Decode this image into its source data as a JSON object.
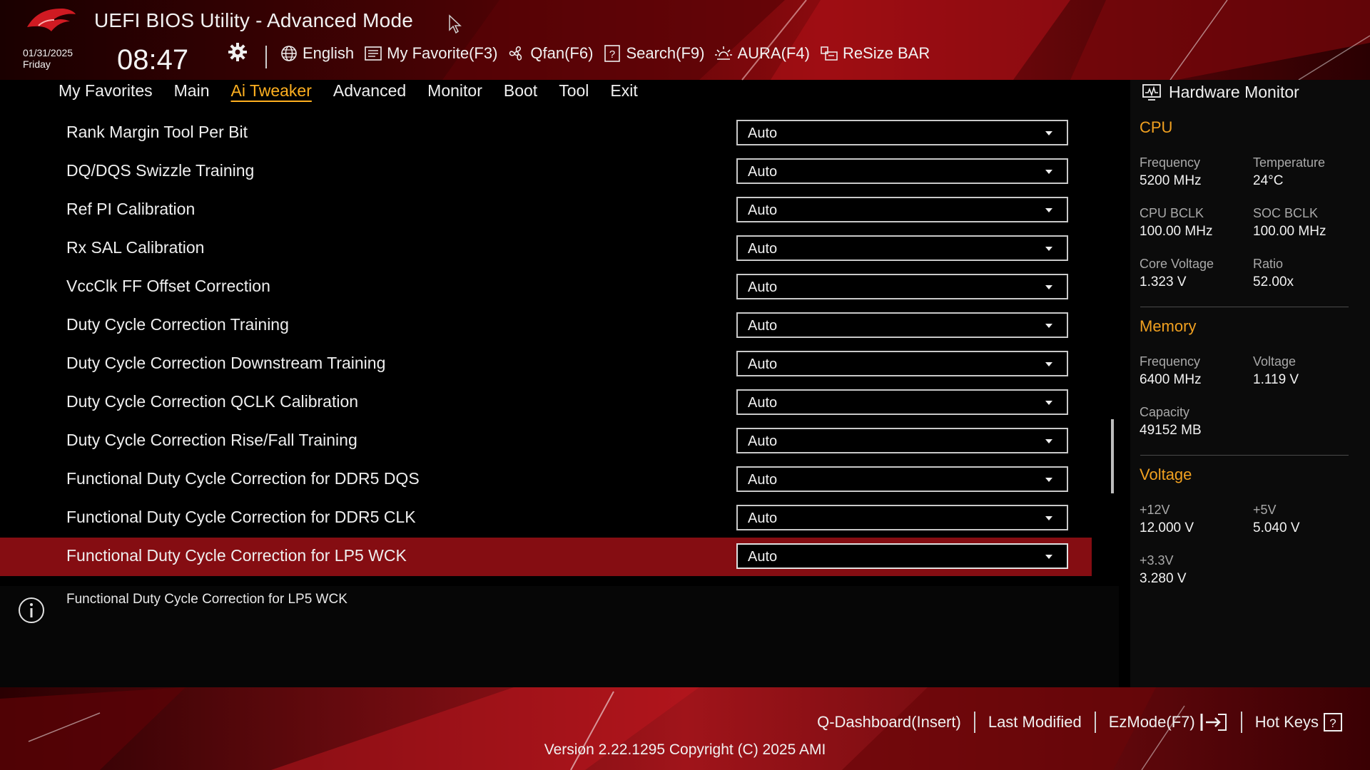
{
  "app": {
    "title": "UEFI BIOS Utility - Advanced Mode",
    "date": "01/31/2025",
    "weekday": "Friday",
    "time": "08:47"
  },
  "toolbar": {
    "items": [
      {
        "label": "English",
        "icon": "globe-icon"
      },
      {
        "label": "My Favorite(F3)",
        "icon": "favorite-icon"
      },
      {
        "label": "Qfan(F6)",
        "icon": "fan-icon"
      },
      {
        "label": "Search(F9)",
        "icon": "search-icon"
      },
      {
        "label": "AURA(F4)",
        "icon": "aura-icon"
      },
      {
        "label": "ReSize BAR",
        "icon": "resize-bar-icon"
      }
    ]
  },
  "menu": {
    "items": [
      "My Favorites",
      "Main",
      "Ai Tweaker",
      "Advanced",
      "Monitor",
      "Boot",
      "Tool",
      "Exit"
    ],
    "active": "Ai Tweaker"
  },
  "settings": [
    {
      "label": "Rank Margin Tool Per Bit",
      "value": "Auto"
    },
    {
      "label": "DQ/DQS Swizzle Training",
      "value": "Auto"
    },
    {
      "label": "Ref PI Calibration",
      "value": "Auto"
    },
    {
      "label": "Rx SAL Calibration",
      "value": "Auto"
    },
    {
      "label": "VccClk FF Offset Correction",
      "value": "Auto"
    },
    {
      "label": "Duty Cycle Correction Training",
      "value": "Auto"
    },
    {
      "label": "Duty Cycle Correction Downstream Training",
      "value": "Auto"
    },
    {
      "label": "Duty Cycle Correction QCLK Calibration",
      "value": "Auto"
    },
    {
      "label": "Duty Cycle Correction Rise/Fall Training",
      "value": "Auto"
    },
    {
      "label": "Functional Duty Cycle Correction for DDR5 DQS",
      "value": "Auto"
    },
    {
      "label": "Functional Duty Cycle Correction for DDR5 CLK",
      "value": "Auto"
    },
    {
      "label": "Functional Duty Cycle Correction for LP5 WCK",
      "value": "Auto",
      "selected": true
    }
  ],
  "info": {
    "text": "Functional Duty Cycle Correction for LP5 WCK"
  },
  "hardware_monitor": {
    "title": "Hardware Monitor",
    "cpu": {
      "heading": "CPU",
      "frequency_label": "Frequency",
      "frequency": "5200 MHz",
      "temperature_label": "Temperature",
      "temperature": "24°C",
      "bclk_label": "CPU BCLK",
      "bclk": "100.00 MHz",
      "soc_bclk_label": "SOC BCLK",
      "soc_bclk": "100.00 MHz",
      "core_voltage_label": "Core Voltage",
      "core_voltage": "1.323 V",
      "ratio_label": "Ratio",
      "ratio": "52.00x"
    },
    "memory": {
      "heading": "Memory",
      "frequency_label": "Frequency",
      "frequency": "6400 MHz",
      "voltage_label": "Voltage",
      "voltage": "1.119 V",
      "capacity_label": "Capacity",
      "capacity": "49152 MB"
    },
    "voltage": {
      "heading": "Voltage",
      "v12_label": "+12V",
      "v12": "12.000 V",
      "v5_label": "+5V",
      "v5": "5.040 V",
      "v33_label": "+3.3V",
      "v33": "3.280 V"
    }
  },
  "footer": {
    "links": [
      "Q-Dashboard(Insert)",
      "Last Modified",
      "EzMode(F7)",
      "Hot Keys"
    ],
    "version": "Version 2.22.1295 Copyright (C) 2025 AMI"
  },
  "colors": {
    "accent": "#ffb020",
    "section": "#f0a020",
    "selected_row": "#850d12",
    "brand_red": "#c41820"
  }
}
